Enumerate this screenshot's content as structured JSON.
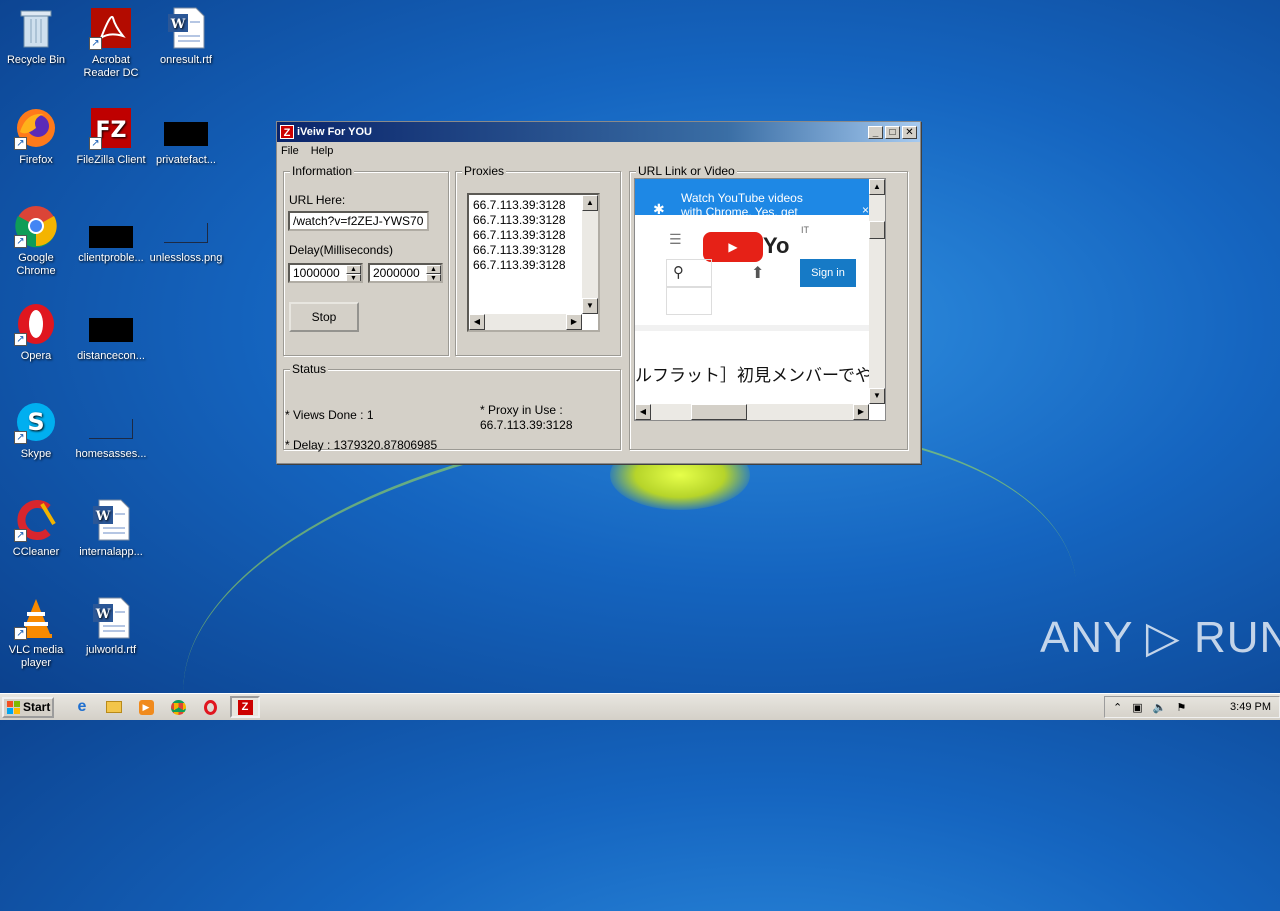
{
  "desktop": {
    "icons": [
      {
        "label": "Recycle Bin"
      },
      {
        "label": "Acrobat Reader DC"
      },
      {
        "label": "onresult.rtf"
      },
      {
        "label": "Firefox"
      },
      {
        "label": "FileZilla Client"
      },
      {
        "label": "privatefact..."
      },
      {
        "label": "Google Chrome"
      },
      {
        "label": "clientproble..."
      },
      {
        "label": "unlessloss.png"
      },
      {
        "label": "Opera"
      },
      {
        "label": "distancecon..."
      },
      {
        "label": "Skype"
      },
      {
        "label": "homesasses..."
      },
      {
        "label": "CCleaner"
      },
      {
        "label": "internalapp..."
      },
      {
        "label": "VLC media player"
      },
      {
        "label": "julworld.rtf"
      }
    ],
    "watermark": "ANY ▷ RUN"
  },
  "window": {
    "app_icon": "Z",
    "title": "iVeiw For YOU",
    "menu": [
      "File",
      "Help"
    ],
    "title_buttons": [
      "_",
      "□",
      "✕"
    ],
    "information": {
      "group_title": "Information",
      "url_label": "URL Here:",
      "url_value": "/watch?v=f2ZEJ-YWS70",
      "delay_label": "Delay(Milliseconds)",
      "delay_min": "1000000",
      "delay_max": "2000000",
      "stop_label": "Stop"
    },
    "proxies": {
      "group_title": "Proxies",
      "items": [
        "66.7.113.39:3128",
        "66.7.113.39:3128",
        "66.7.113.39:3128",
        "66.7.113.39:3128",
        "66.7.113.39:3128"
      ]
    },
    "url_link": {
      "group_title": "URL Link or Video",
      "banner_text_1": "Watch YouTube videos",
      "banner_text_2": "with Chrome.    Yes, get",
      "banner_close": "×",
      "logo_text": "Yo",
      "region": "IT",
      "signin": "Sign in",
      "video_title": "ルフラット］初見メンバーでやる"
    },
    "status": {
      "group_title": "Status",
      "views_done": "* Views Done :  1",
      "delay": "* Delay :  1379320.87806985",
      "proxy_label": "* Proxy in Use :",
      "proxy_value": "66.7.113.39:3128"
    }
  },
  "taskbar": {
    "start_label": "Start",
    "clock": "3:49 PM"
  }
}
